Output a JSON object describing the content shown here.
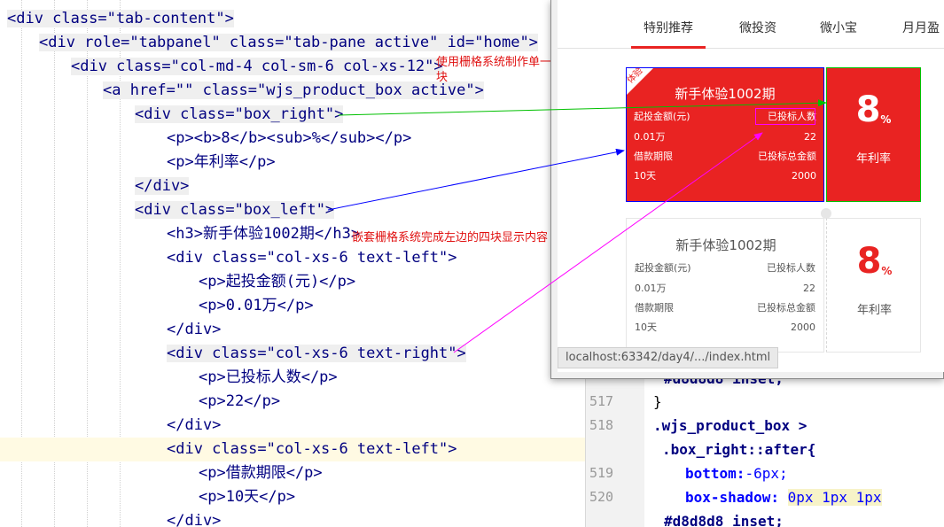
{
  "html_code": {
    "line0": "<div class=\"tab-content\">",
    "line1": "<div role=\"tabpanel\" class=\"tab-pane active\" id=\"home\">",
    "line2": "<div class=\"col-md-4 col-sm-6 col-xs-12\">",
    "line3": "<a href=\"\" class=\"wjs_product_box active\">",
    "line4": "<div class=\"box_right\">",
    "line5": "<p><b>8</b><sub>%</sub></p>",
    "line6": "<p>年利率</p>",
    "line7": "</div>",
    "line8": "<div class=\"box_left\">",
    "line9": "<h3>新手体验1002期</h3>",
    "line10": "<div class=\"col-xs-6 text-left\">",
    "line11": "<p>起投金额(元)</p>",
    "line12": "<p>0.01万</p>",
    "line13": "</div>",
    "line14": "<div class=\"col-xs-6 text-right\">",
    "line15": "<p>已投标人数</p>",
    "line16": "<p>22</p>",
    "line17": "</div>",
    "line18": "<div class=\"col-xs-6 text-left\">",
    "line19": "<p>借款期限</p>",
    "line20": "<p>10天</p>",
    "line21": "</div>"
  },
  "annotations": {
    "grid_note_1": "使用栅格系统制作单一信息",
    "grid_note_2": "块",
    "nested_note": "嵌套栅格系统完成左边的四块显示内容"
  },
  "css_code": {
    "ln517": "517",
    "ln518": "518",
    "ln519": "519",
    "ln520": "520",
    "top_partial": "#d8d8d8 inset;",
    "close": "}",
    "sel_part1": ".wjs_product_box >",
    "sel_part2": ".box_right::after{",
    "bottom_prop": "bottom:",
    "bottom_val": "-6px;",
    "shadow_prop": "box-shadow: ",
    "shadow_val": "0px 1px 1px",
    "end_val": "#d8d8d8 inset;"
  },
  "browser": {
    "tabs": [
      "特别推荐",
      "微投资",
      "微小宝",
      "月月盈"
    ],
    "active_tab": 0,
    "status_url": "localhost:63342/day4/.../index.html",
    "cards": [
      {
        "corner_label": "体验",
        "title": "新手体验1002期",
        "min_invest_label": "起投金额(元)",
        "min_invest_value": "0.01万",
        "investors_label": "已投标人数",
        "investors_value": "22",
        "term_label": "借款期限",
        "term_value": "10天",
        "total_label": "已投标总金额",
        "total_value": "2000",
        "rate": "8",
        "rate_unit": "%",
        "rate_label": "年利率"
      },
      {
        "title": "新手体验1002期",
        "min_invest_label": "起投金额(元)",
        "min_invest_value": "0.01万",
        "investors_label": "已投标人数",
        "investors_value": "22",
        "term_label": "借款期限",
        "term_value": "10天",
        "total_label": "已投标总金额",
        "total_value": "2000",
        "rate": "8",
        "rate_unit": "%",
        "rate_label": "年利率"
      }
    ]
  },
  "colors": {
    "brand_red": "#e92322",
    "arrow_green": "#00c000",
    "arrow_blue": "#0000ff",
    "arrow_magenta": "#ff00ff"
  }
}
